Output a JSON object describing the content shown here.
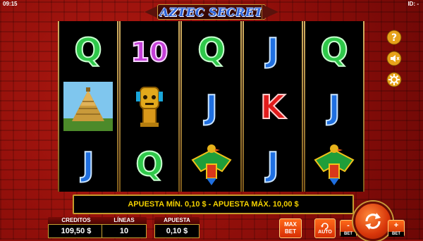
{
  "status": {
    "clock": "09:15",
    "id": "ID: -"
  },
  "game": {
    "title": "AZTEC SECRET"
  },
  "reels": [
    [
      "Q",
      "temple",
      "J"
    ],
    [
      "10",
      "idol",
      "Q"
    ],
    [
      "Q",
      "J",
      "bird"
    ],
    [
      "J",
      "K",
      "J"
    ],
    [
      "Q",
      "J",
      "bird"
    ]
  ],
  "info": {
    "message": "APUESTA MÍN. 0,10 $ - APUESTA MÁX. 10,00 $"
  },
  "panels": {
    "credits": {
      "label": "CREDITOS",
      "value": "109,50 $"
    },
    "lines": {
      "label": "LÍNEAS",
      "value": "10"
    },
    "bet": {
      "label": "APUESTA",
      "value": "0,10 $"
    }
  },
  "buttons": {
    "maxbet_line1": "MAX",
    "maxbet_line2": "BET",
    "auto": "AUTO",
    "bet_minus": "-",
    "bet_minus_tag": "BET",
    "bet_plus": "+",
    "bet_plus_tag": "BET"
  },
  "side_buttons": [
    "help-icon",
    "sound-icon",
    "settings-icon"
  ],
  "colors": {
    "accent": "#f2d000",
    "frame": "#c59b2c",
    "button": "#ff6a1a",
    "background": "#8e0f0a"
  }
}
